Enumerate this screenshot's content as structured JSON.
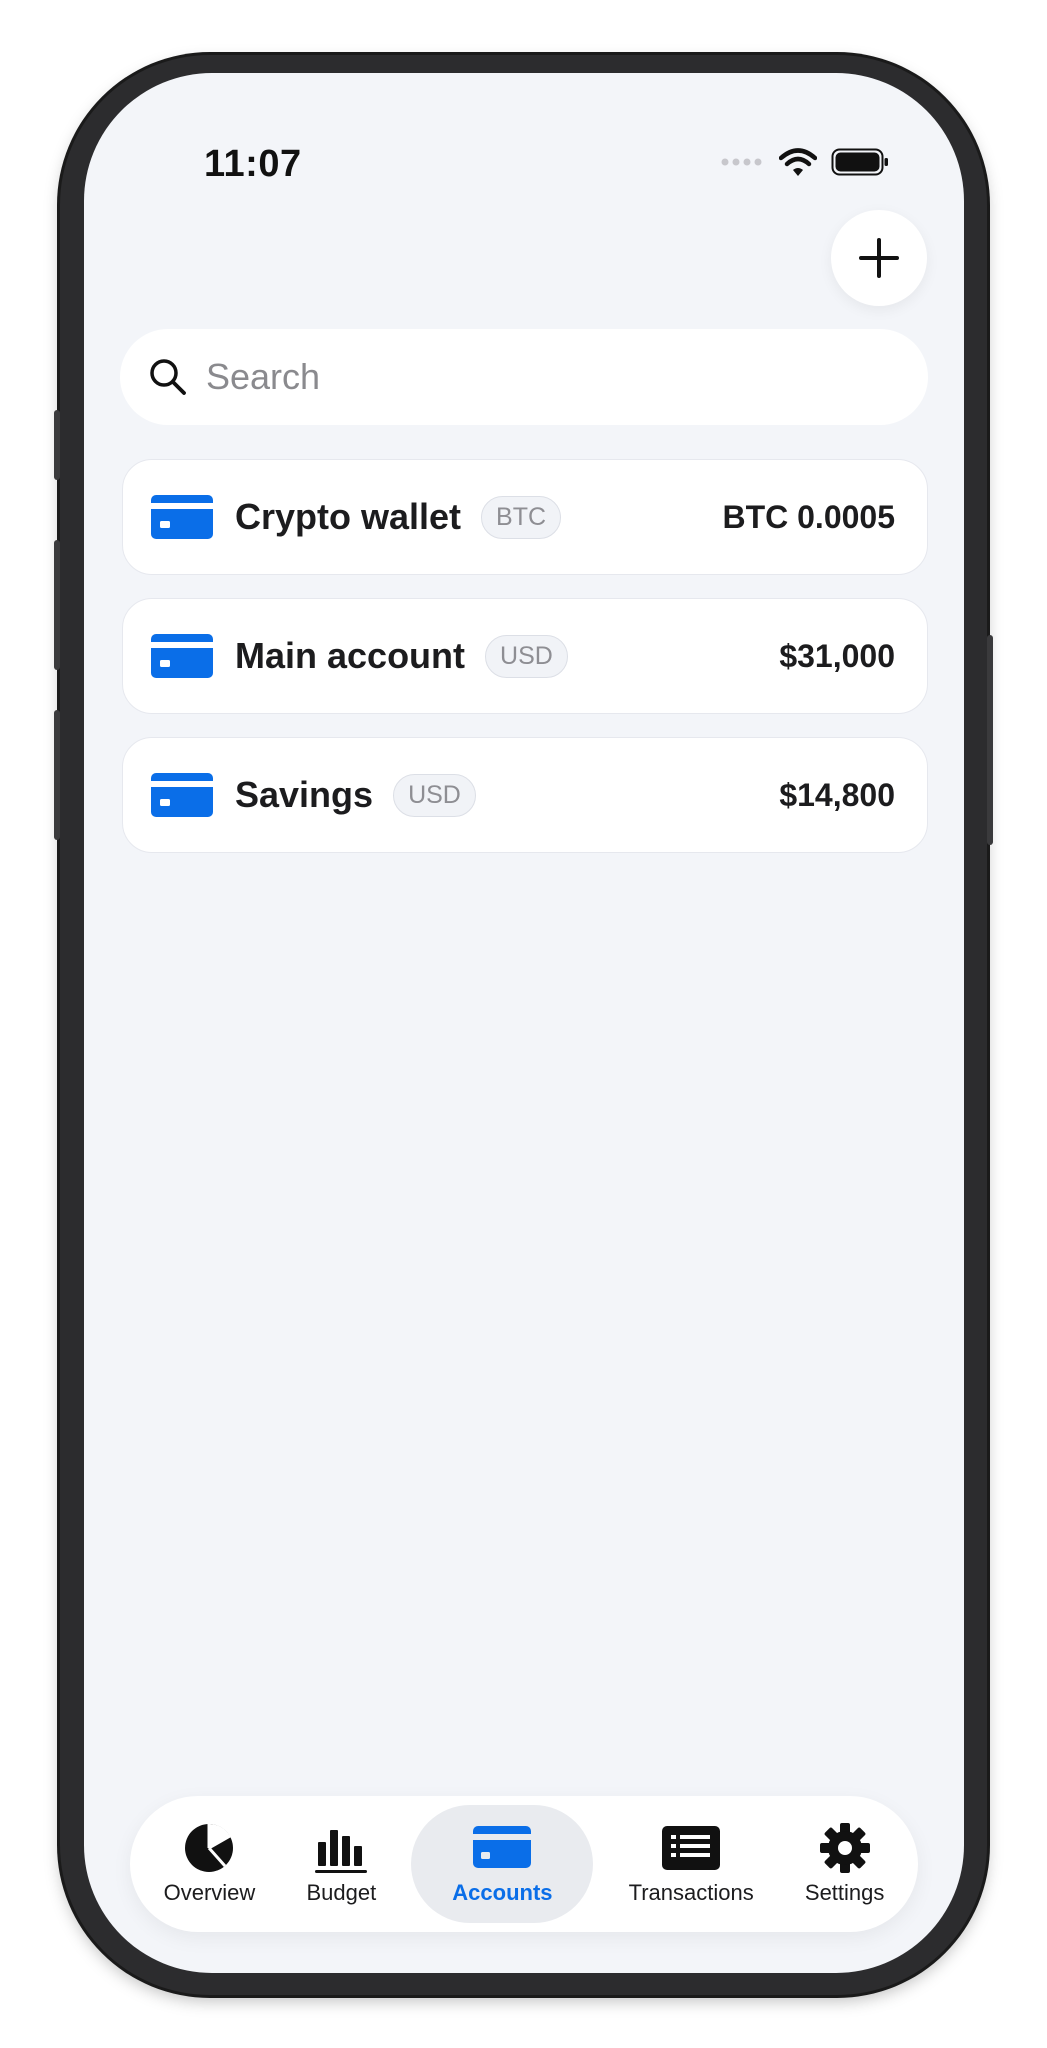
{
  "status_bar": {
    "time": "11:07"
  },
  "colors": {
    "accent": "#0a6ee8",
    "background": "#f3f5f9"
  },
  "header": {
    "add_icon": "plus-icon"
  },
  "search": {
    "placeholder": "Search",
    "value": ""
  },
  "accounts": [
    {
      "name": "Crypto wallet",
      "currency": "BTC",
      "balance": "BTC 0.0005"
    },
    {
      "name": "Main account",
      "currency": "USD",
      "balance": "$31,000"
    },
    {
      "name": "Savings",
      "currency": "USD",
      "balance": "$14,800"
    }
  ],
  "tabs": [
    {
      "label": "Overview",
      "icon": "pie-chart-icon",
      "active": false
    },
    {
      "label": "Budget",
      "icon": "bar-chart-icon",
      "active": false
    },
    {
      "label": "Accounts",
      "icon": "credit-card-icon",
      "active": true
    },
    {
      "label": "Transactions",
      "icon": "list-icon",
      "active": false
    },
    {
      "label": "Settings",
      "icon": "gear-icon",
      "active": false
    }
  ]
}
